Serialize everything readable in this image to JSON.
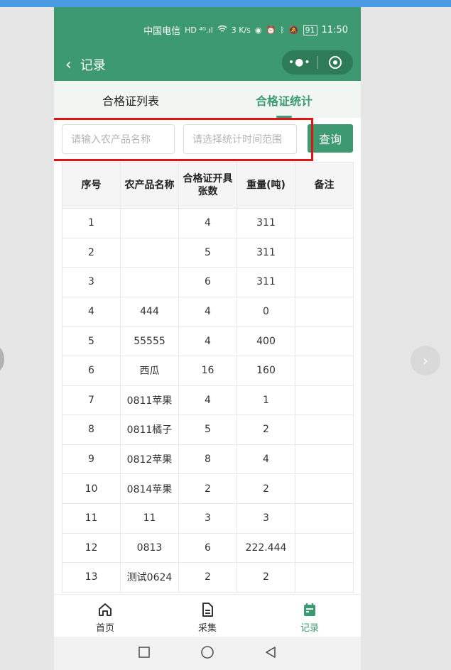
{
  "status_bar": {
    "carrier": "中国电信",
    "indicators": "HD ⁴ᴳ.ıl",
    "speed": "3 K/s",
    "battery": "91",
    "time": "11:50"
  },
  "nav": {
    "back_icon": "chevron-left-icon",
    "title": "记录"
  },
  "tabs": [
    {
      "label": "合格证列表",
      "active": false
    },
    {
      "label": "合格证统计",
      "active": true
    }
  ],
  "search": {
    "product_placeholder": "请输入农产品名称",
    "time_placeholder": "请选择统计时间范围",
    "query_label": "查询"
  },
  "table": {
    "headers": [
      "序号",
      "农产品名称",
      "合格证开具张数",
      "重量(吨)",
      "备注"
    ],
    "rows": [
      [
        "1",
        "",
        "4",
        "311",
        ""
      ],
      [
        "2",
        "",
        "5",
        "311",
        ""
      ],
      [
        "3",
        "",
        "6",
        "311",
        ""
      ],
      [
        "4",
        "444",
        "4",
        "0",
        ""
      ],
      [
        "5",
        "55555",
        "4",
        "400",
        ""
      ],
      [
        "6",
        "西瓜",
        "16",
        "160",
        ""
      ],
      [
        "7",
        "0811苹果",
        "4",
        "1",
        ""
      ],
      [
        "8",
        "0811橘子",
        "5",
        "2",
        ""
      ],
      [
        "9",
        "0812苹果",
        "8",
        "4",
        ""
      ],
      [
        "10",
        "0814苹果",
        "2",
        "2",
        ""
      ],
      [
        "11",
        "11",
        "3",
        "3",
        ""
      ],
      [
        "12",
        "0813",
        "6",
        "222.444",
        ""
      ],
      [
        "13",
        "测试0624",
        "2",
        "2",
        ""
      ]
    ]
  },
  "tabbar": [
    {
      "label": "首页",
      "icon": "home-icon",
      "active": false
    },
    {
      "label": "采集",
      "icon": "document-icon",
      "active": false
    },
    {
      "label": "记录",
      "icon": "calendar-icon",
      "active": true
    }
  ],
  "colors": {
    "brand": "#3d9a70",
    "highlight": "#e01414"
  }
}
